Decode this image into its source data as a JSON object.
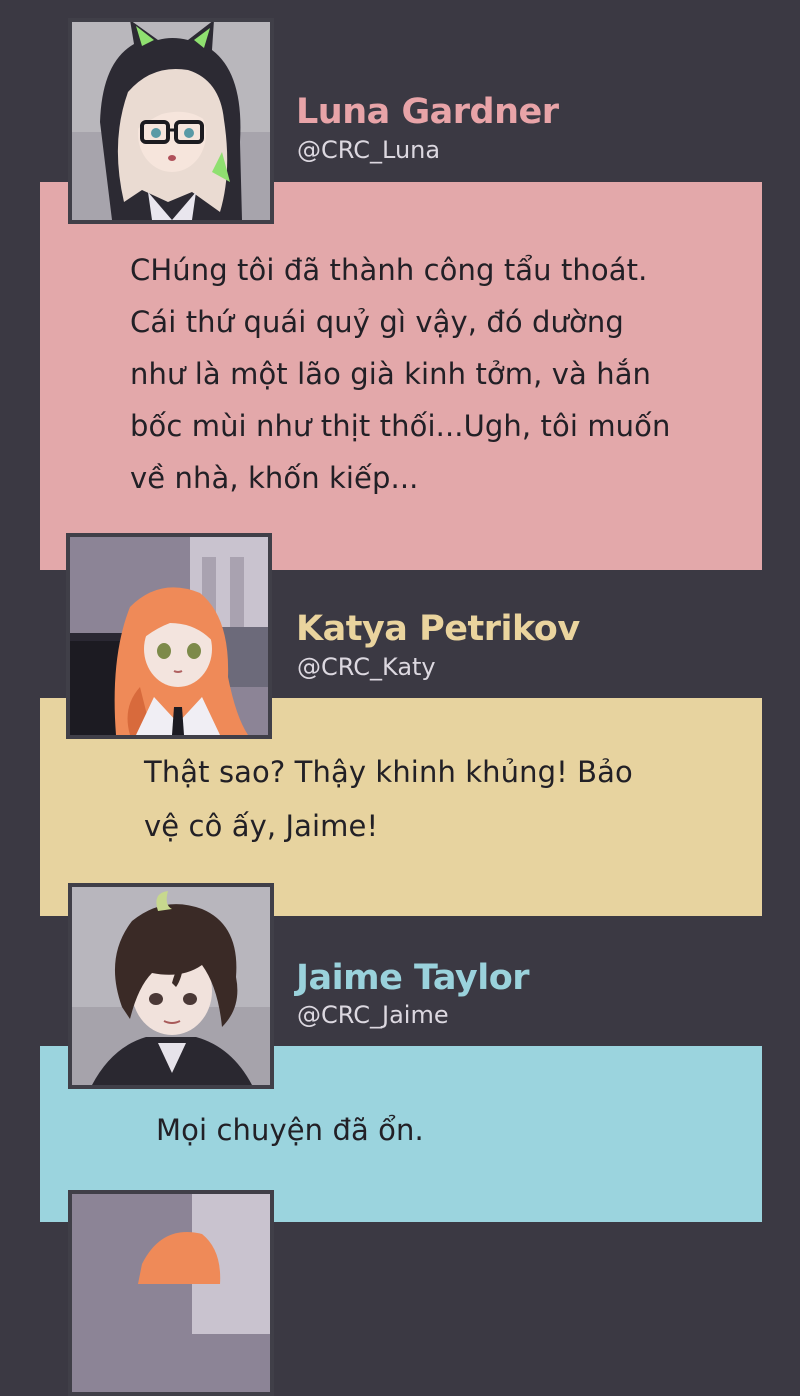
{
  "messages": [
    {
      "name": "Luna Gardner",
      "handle": "@CRC_Luna",
      "text_lines": [
        "CHúng tôi đã thành công tẩu thoát.",
        "Cái thứ quái quỷ gì vậy, đó dường",
        "như là một lão già kinh tởm, và hắn",
        "bốc mùi như thịt thối...Ugh, tôi muốn",
        "về nhà, khốn kiếp..."
      ],
      "name_color": "#e8a4a8",
      "bubble_color": "#e3a8aa"
    },
    {
      "name": "Katya Petrikov",
      "handle": "@CRC_Katy",
      "text_lines": [
        "Thật sao? Thậy khinh khủng! Bảo",
        "vệ cô ấy, Jaime!"
      ],
      "name_color": "#ead49e",
      "bubble_color": "#e7d39f"
    },
    {
      "name": "Jaime Taylor",
      "handle": "@CRC_Jaime",
      "text_lines": [
        "Mọi chuyện đã ổn."
      ],
      "name_color": "#9ad2dc",
      "bubble_color": "#9bd4de"
    }
  ],
  "colors": {
    "background": "#3b3943",
    "text": "#222026",
    "handle": "#dcd8e0"
  }
}
